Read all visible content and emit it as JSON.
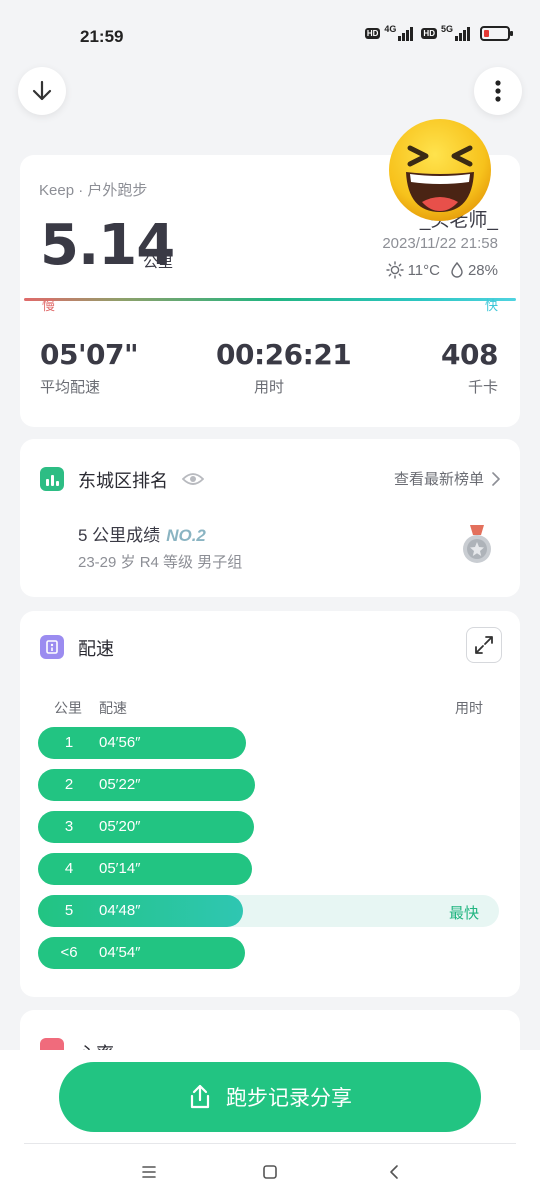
{
  "status_bar": {
    "time": "21:59",
    "net1": "4G",
    "net2": "5G",
    "hd": "HD"
  },
  "toolbar": {
    "back_icon": "arrow-down-icon",
    "more_icon": "more-vertical-icon"
  },
  "summary": {
    "source": "Keep · 户外跑步",
    "distance": "5.14",
    "distance_unit": "公里",
    "username": "_头老师_",
    "datetime": "2023/11/22 21:58",
    "temperature": "11°C",
    "humidity": "28%",
    "slow_label": "慢",
    "fast_label": "快",
    "stats": [
      {
        "value": "05'07\"",
        "label": "平均配速"
      },
      {
        "value": "00:26:21",
        "label": "用时"
      },
      {
        "value": "408",
        "label": "千卡"
      }
    ]
  },
  "ranking": {
    "title": "东城区排名",
    "link": "查看最新榜单",
    "score_label": "5 公里成绩",
    "rank": "NO.2",
    "group": "23-29 岁 R4 等级 男子组"
  },
  "pace": {
    "title": "配速",
    "col_km": "公里",
    "col_pace": "配速",
    "col_time": "用时",
    "fastest_tag": "最快",
    "rows": [
      {
        "km": "1",
        "pace": "04′56″",
        "fill": 0.451
      },
      {
        "km": "2",
        "pace": "05′22″",
        "fill": 0.471
      },
      {
        "km": "3",
        "pace": "05′20″",
        "fill": 0.469
      },
      {
        "km": "4",
        "pace": "05′14″",
        "fill": 0.464
      },
      {
        "km": "5",
        "pace": "04′48″",
        "fill": 0.444,
        "fastest": true
      },
      {
        "km": "<6",
        "pace": "04′54″",
        "fill": 0.449
      }
    ]
  },
  "heart_rate": {
    "title": "心率"
  },
  "share": {
    "label": "跑步记录分享"
  },
  "colors": {
    "accent": "#22c482",
    "rank_accent": "#8ab4c2",
    "slow": "#e06a6a",
    "fast": "#3dc7d8"
  }
}
